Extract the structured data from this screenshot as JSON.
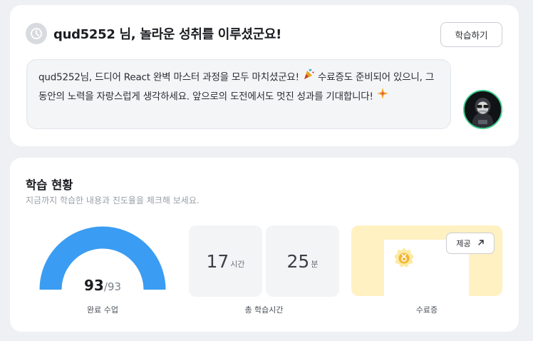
{
  "welcome": {
    "title": "qud5252 님, 놀라운 성취를 이루셨군요!",
    "study_button": "학습하기",
    "message_part1": "qud5252님, 드디어 React 완벽 마스터 과정을 모두 마치셨군요!",
    "message_part2": " 수료증도 준비되어 있으니, 그동안의 노력을 자랑스럽게 생각하세요. 앞으로의 도전에서도 멋진 성과를 기대합니다!",
    "icons": [
      "clock-badge-icon",
      "party-popper-icon",
      "sparkle-icon"
    ]
  },
  "progress": {
    "title": "학습 현황",
    "subtitle": "지금까지 학습한 내용과 진도율을 체크해 보세요.",
    "completed": "93",
    "total": "/93",
    "completed_fraction": 1.0,
    "completed_label": "완료 수업",
    "hours": "17",
    "hours_unit": "시간",
    "minutes": "25",
    "minutes_unit": "분",
    "time_label": "총 학습시간",
    "provide_button": "제공",
    "certificate_label": "수료증"
  },
  "colors": {
    "accent": "#3a9cf2",
    "avatar_ring": "#3ecf8e",
    "certificate_bg": "#fff1c2",
    "medal": "#f3b531"
  }
}
